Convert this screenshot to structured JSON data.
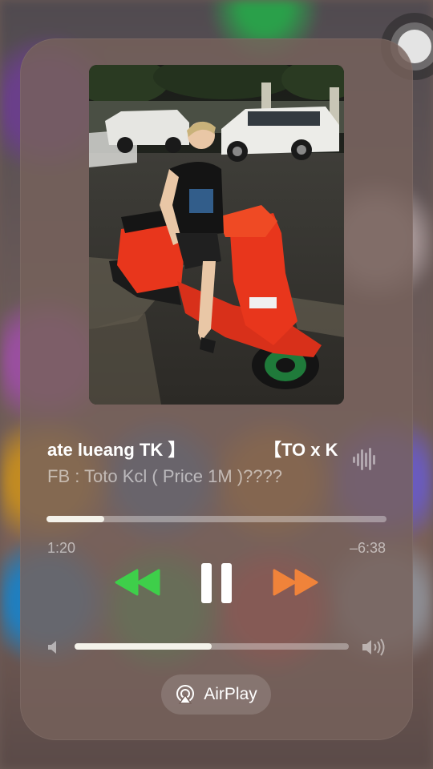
{
  "now_playing": {
    "title_left": "ate lueang TK 】",
    "title_right": "【TO x K",
    "artist": "FB : Toto Kcl  ( Price 1M )????",
    "elapsed": "1:20",
    "remaining": "–6:38",
    "progress": 0.17
  },
  "volume": {
    "level": 0.5
  },
  "airplay": {
    "label": "AirPlay"
  },
  "colors": {
    "rewind": "#3ecf4a",
    "fast_forward": "#f0833a",
    "pause": "#ffffff"
  },
  "icons": {
    "rewind": "backward-icon",
    "pause": "pause-icon",
    "fast_forward": "forward-icon",
    "volume_low": "speaker-low-icon",
    "volume_high": "speaker-high-icon",
    "airplay": "airplay-icon",
    "now_playing": "waveform-icon"
  }
}
